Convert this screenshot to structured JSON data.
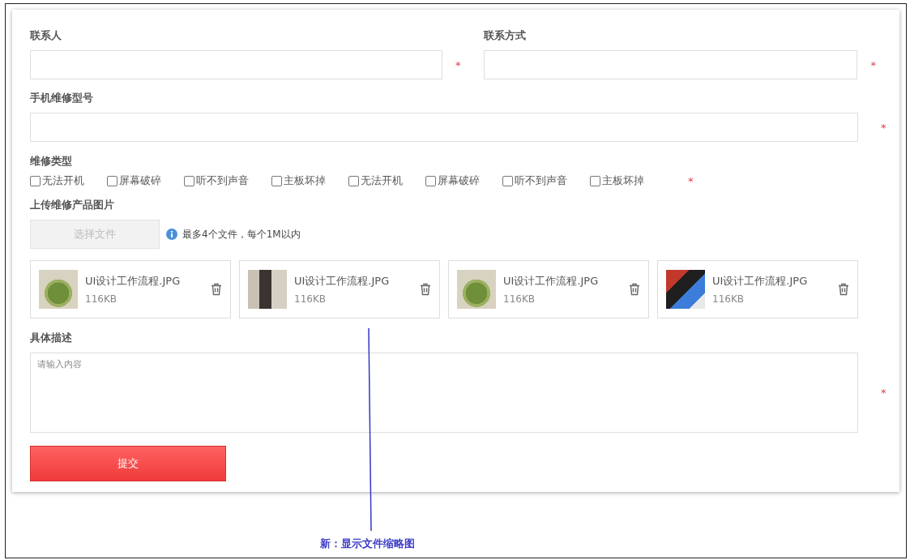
{
  "contact_fields": [
    {
      "label": "联系人",
      "required_mark": "*"
    },
    {
      "label": "联系方式",
      "required_mark": "*"
    }
  ],
  "model_field": {
    "label": "手机维修型号",
    "required_mark": "*"
  },
  "repair_type": {
    "label": "维修类型",
    "required_mark": "*",
    "options": [
      {
        "label": "无法开机",
        "checked": false
      },
      {
        "label": "屏幕破碎",
        "checked": false
      },
      {
        "label": "听不到声音",
        "checked": false
      },
      {
        "label": "主板坏掉",
        "checked": false
      },
      {
        "label": "无法开机",
        "checked": false
      },
      {
        "label": "屏幕破碎",
        "checked": false
      },
      {
        "label": "听不到声音",
        "checked": false
      },
      {
        "label": "主板坏掉",
        "checked": false
      }
    ]
  },
  "upload": {
    "label": "上传维修产品图片",
    "button": "选择文件",
    "hint": "最多4个文件，每个1M以内",
    "files": [
      {
        "name": "UI设计工作流程.JPG",
        "size": "116KB",
        "kind": "cactus"
      },
      {
        "name": "UI设计工作流程.JPG",
        "size": "116KB",
        "kind": "bottle"
      },
      {
        "name": "UI设计工作流程.JPG",
        "size": "116KB",
        "kind": "cactus"
      },
      {
        "name": "UI设计工作流程.JPG",
        "size": "116KB",
        "kind": "abstract"
      }
    ]
  },
  "description": {
    "label": "具体描述",
    "placeholder": "请输入内容",
    "required_mark": "*"
  },
  "submit": "提交",
  "annotation": "新：显示文件缩略图"
}
